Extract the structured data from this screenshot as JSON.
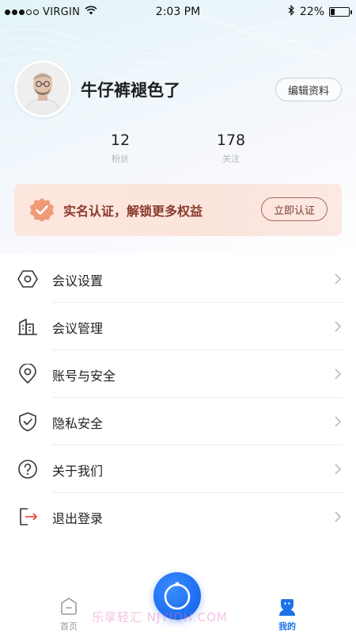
{
  "status_bar": {
    "carrier": "VIRGIN",
    "time": "2:03 PM",
    "battery": "22%",
    "battery_level": 0.22,
    "signal_bars": 5,
    "signal_filled": 3
  },
  "profile": {
    "name": "牛仔裤褪色了",
    "edit_label": "编辑资料",
    "stats": [
      {
        "value": "12",
        "label": "粉丝"
      },
      {
        "value": "178",
        "label": "关注"
      }
    ]
  },
  "verify": {
    "text": "实名认证，解锁更多权益",
    "button": "立即认证"
  },
  "menu": [
    {
      "label": "会议设置",
      "icon": "hexagon-settings-icon"
    },
    {
      "label": "会议管理",
      "icon": "buildings-icon"
    },
    {
      "label": "账号与安全",
      "icon": "location-pin-icon"
    },
    {
      "label": "隐私安全",
      "icon": "shield-check-icon"
    },
    {
      "label": "关于我们",
      "icon": "question-circle-icon"
    },
    {
      "label": "退出登录",
      "icon": "logout-icon"
    }
  ],
  "tabbar": {
    "home_label": "首页",
    "mine_label": "我的",
    "center_icon": "camera-lens-icon"
  },
  "watermark": "乐享轻汇 NJYIQH.COM",
  "colors": {
    "accent": "#1e72e8",
    "verify_text": "#8a3b2c",
    "verify_bg": "#fde7df",
    "logout_arrow": "#e5432f"
  }
}
